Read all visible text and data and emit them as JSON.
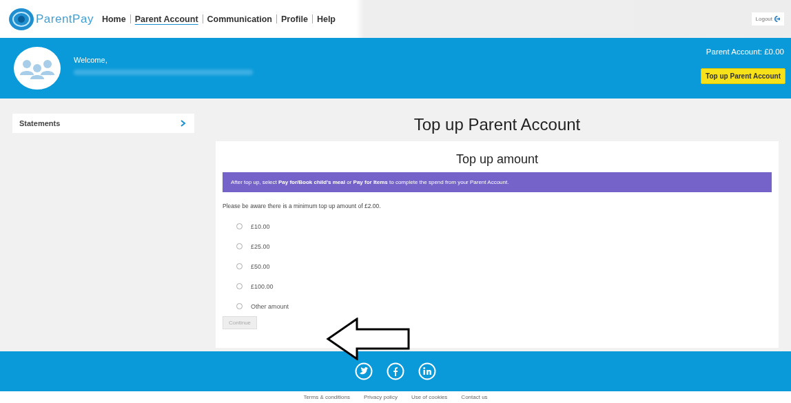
{
  "header": {
    "logo": "ParentPay",
    "nav": [
      {
        "label": "Home",
        "selected": false
      },
      {
        "label": "Parent Account",
        "selected": true
      },
      {
        "label": "Communication",
        "selected": false
      },
      {
        "label": "Profile",
        "selected": false
      },
      {
        "label": "Help",
        "selected": false
      }
    ],
    "logout": "Logout"
  },
  "banner": {
    "welcome": "Welcome,",
    "balance": "Parent Account: £0.00",
    "top_up_button": "Top up Parent Account"
  },
  "sidebar": {
    "items": [
      {
        "label": "Statements"
      }
    ]
  },
  "main": {
    "title": "Top up Parent Account",
    "card_title": "Top up amount",
    "notice": "After top up, select **Pay for/Book child's meal** or **Pay for Items** to complete the spend from your Parent Account.",
    "minimum_note": "Please be aware there is a minimum top up amount of £2.00.",
    "options": [
      {
        "label": "£10.00",
        "selected": false
      },
      {
        "label": "£25.00",
        "selected": false
      },
      {
        "label": "£50.00",
        "selected": false
      },
      {
        "label": "£100.00",
        "selected": false
      },
      {
        "label": "Other amount",
        "selected": false
      }
    ],
    "continue_button": {
      "label": "Continue",
      "disabled": true
    }
  },
  "footer": {
    "social": [
      {
        "kind": "twitter"
      },
      {
        "kind": "facebook"
      },
      {
        "kind": "linkedin"
      }
    ],
    "links": [
      "Terms & conditions",
      "Privacy policy",
      "Use of cookies",
      "Contact us"
    ]
  }
}
